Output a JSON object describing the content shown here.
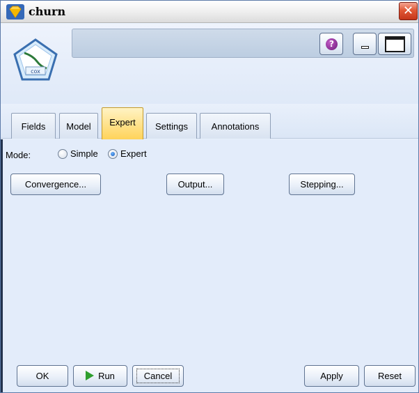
{
  "window": {
    "title": "churn",
    "node_icon_label": "cox",
    "name_field_value": ""
  },
  "tabs": [
    {
      "label": "Fields"
    },
    {
      "label": "Model"
    },
    {
      "label": "Expert"
    },
    {
      "label": "Settings"
    },
    {
      "label": "Annotations"
    }
  ],
  "mode": {
    "label": "Mode:",
    "options": [
      {
        "label": "Simple",
        "selected": false
      },
      {
        "label": "Expert",
        "selected": true
      }
    ]
  },
  "expert_buttons": {
    "convergence": "Convergence...",
    "output": "Output...",
    "stepping": "Stepping..."
  },
  "footer": {
    "ok": "OK",
    "run": "Run",
    "cancel": "Cancel",
    "apply": "Apply",
    "reset": "Reset"
  },
  "colors": {
    "active_tab": "#ffd35a",
    "close_button": "#e15836",
    "run_icon": "#2e9e2e",
    "help_icon": "#8e2c9c"
  },
  "icons": [
    "diamond-app-icon",
    "close-icon",
    "cox-node-icon",
    "help-icon",
    "minimize-icon",
    "maximize-icon",
    "run-play-icon"
  ]
}
